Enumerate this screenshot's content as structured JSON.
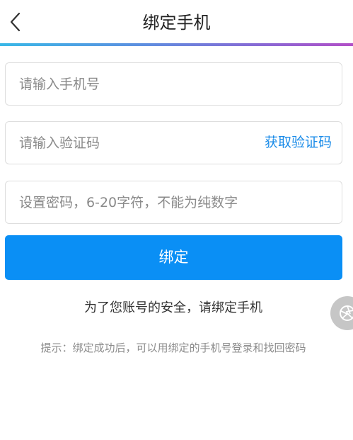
{
  "header": {
    "title": "绑定手机",
    "back_icon": "chevron-left-icon"
  },
  "form": {
    "phone_placeholder": "请输入手机号",
    "code_placeholder": "请输入验证码",
    "get_code_label": "获取验证码",
    "password_placeholder": "设置密码，6-20字符，不能为纯数字",
    "bind_button_label": "绑定"
  },
  "notes": {
    "security": "为了您账号的安全，请绑定手机",
    "tip": "提示：绑定成功后，可以用绑定的手机号登录和找回密码"
  },
  "floating": {
    "icon": "aperture-icon"
  },
  "colors": {
    "accent": "#0a8ff5",
    "link": "#1a8be8",
    "gradient_start": "#39b8e7",
    "gradient_end": "#b24fc7"
  }
}
